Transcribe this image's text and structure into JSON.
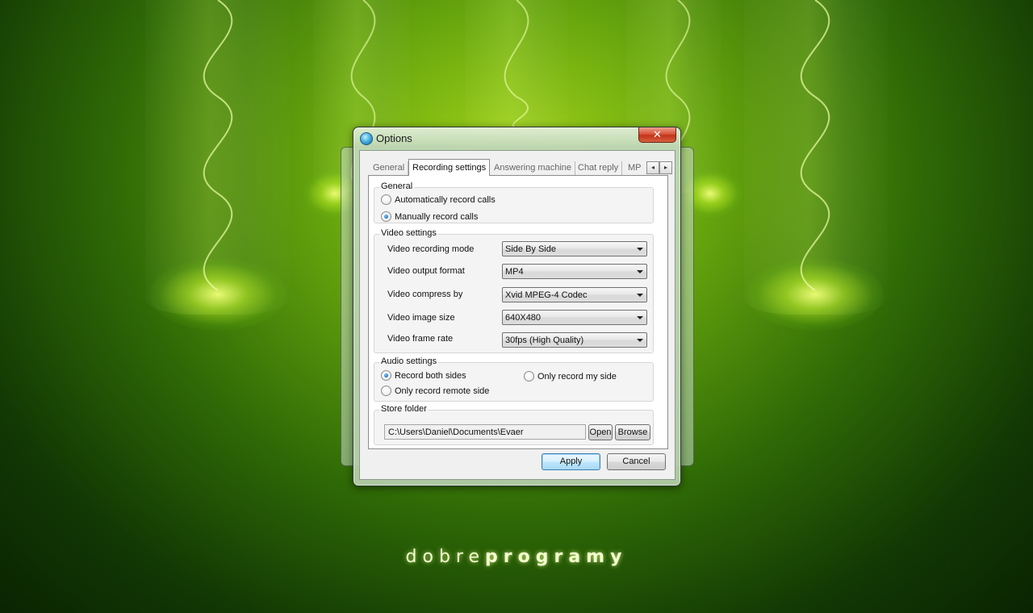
{
  "dialog": {
    "title": "Options",
    "close_glyph": "✕"
  },
  "tabs": [
    {
      "label": "General",
      "active": false
    },
    {
      "label": "Recording settings",
      "active": true
    },
    {
      "label": "Answering machine",
      "active": false
    },
    {
      "label": "Chat reply",
      "active": false
    },
    {
      "label": "MP",
      "active": false
    }
  ],
  "tab_scroll": {
    "left": "◂",
    "right": "▸"
  },
  "general_group": {
    "title": "General",
    "options": [
      {
        "label": "Automatically record calls",
        "checked": false
      },
      {
        "label": "Manually record calls",
        "checked": true
      }
    ]
  },
  "video_group": {
    "title": "Video settings",
    "settings": [
      {
        "label": "Video recording mode",
        "value": "Side By Side"
      },
      {
        "label": "Video output format",
        "value": "MP4"
      },
      {
        "label": "Video compress by",
        "value": "Xvid MPEG-4 Codec"
      },
      {
        "label": "Video image size",
        "value": "640X480"
      },
      {
        "label": "Video frame rate",
        "value": "30fps (High Quality)"
      }
    ]
  },
  "audio_group": {
    "title": "Audio settings",
    "options": [
      {
        "label": "Record both sides",
        "checked": true
      },
      {
        "label": "Only record my side",
        "checked": false
      },
      {
        "label": "Only record remote side",
        "checked": false
      }
    ]
  },
  "store_group": {
    "title": "Store folder",
    "path": "C:\\Users\\Daniel\\Documents\\Evaer",
    "open_label": "Open",
    "browse_label": "Browse"
  },
  "buttons": {
    "apply": "Apply",
    "cancel": "Cancel"
  },
  "watermark": {
    "light": "dobre",
    "bold": "programy"
  },
  "colors": {
    "background_green": "#6aa80e",
    "close_red": "#d9543a",
    "default_button_blue": "#3c7fb1"
  }
}
